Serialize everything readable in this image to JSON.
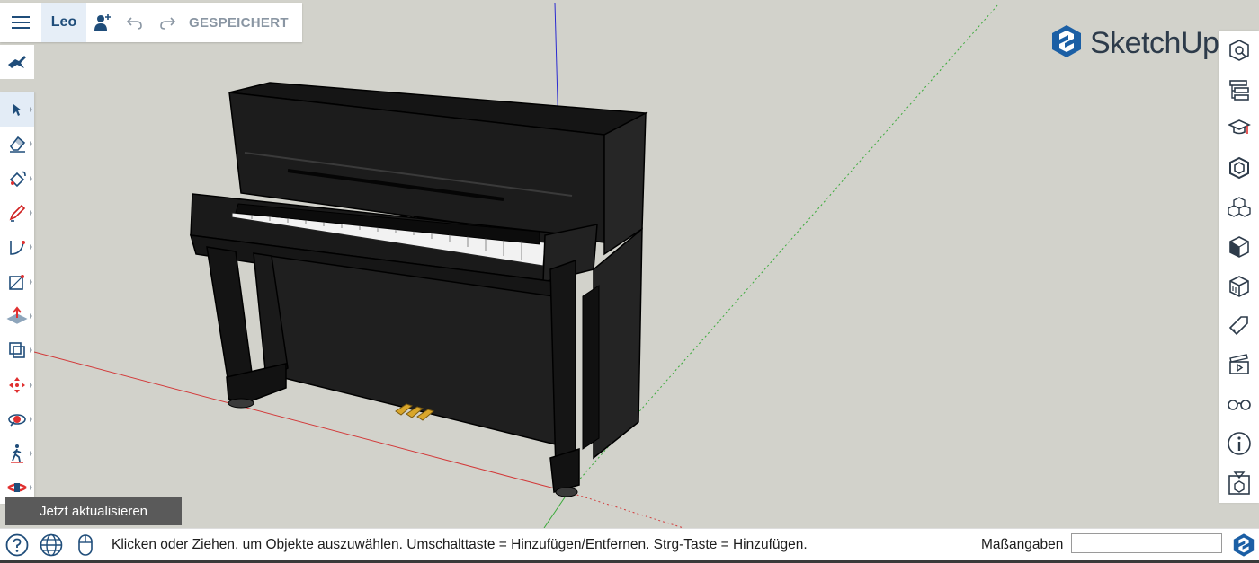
{
  "topbar": {
    "menu_icon": "hamburger-menu-icon",
    "user_name": "Leo",
    "add_user_icon": "add-user-icon",
    "undo_icon": "undo-icon",
    "redo_icon": "redo-icon",
    "save_status": "GESPEICHERT"
  },
  "left_toolbar": {
    "search_tool_icon": "search-tool-icon",
    "tools": [
      {
        "name": "select",
        "icon": "select-arrow-icon",
        "active": true
      },
      {
        "name": "eraser",
        "icon": "eraser-icon"
      },
      {
        "name": "paint",
        "icon": "paint-bucket-icon"
      },
      {
        "name": "pencil",
        "icon": "pencil-icon"
      },
      {
        "name": "arc",
        "icon": "arc-icon"
      },
      {
        "name": "rectangle",
        "icon": "rectangle-icon"
      },
      {
        "name": "push-pull",
        "icon": "push-pull-icon"
      },
      {
        "name": "offset",
        "icon": "offset-icon"
      },
      {
        "name": "move",
        "icon": "move-icon"
      },
      {
        "name": "orbit",
        "icon": "orbit-icon"
      },
      {
        "name": "walk",
        "icon": "walk-icon"
      },
      {
        "name": "section",
        "icon": "section-plane-icon"
      }
    ]
  },
  "update_banner": "Jetzt aktualisieren",
  "logo": {
    "text": "SketchUp",
    "icon": "sketchup-logo-icon"
  },
  "right_toolbar": [
    "entity-info-icon",
    "outliner-icon",
    "instructor-icon",
    "components-icon",
    "materials-icon",
    "styles-icon",
    "scenes-icon",
    "tags-icon",
    "animation-icon",
    "display-icon",
    "info-icon",
    "3d-warehouse-icon"
  ],
  "statusbar": {
    "help_icon": "help-icon",
    "globe_icon": "globe-icon",
    "mouse_icon": "mouse-icon",
    "message": "Klicken oder Ziehen, um Objekte auszuwählen. Umschalttaste = Hinzufügen/Entfernen. Strg-Taste = Hinzufügen.",
    "measurements_label": "Maßangaben",
    "measurements_value": ""
  },
  "colors": {
    "canvas": "#d2d2cb",
    "toolbar": "#ffffff",
    "accent": "#1f4d7a",
    "axis_red": "#d23a3a",
    "axis_green": "#3aaa3a",
    "axis_blue": "#2a2ad0"
  }
}
